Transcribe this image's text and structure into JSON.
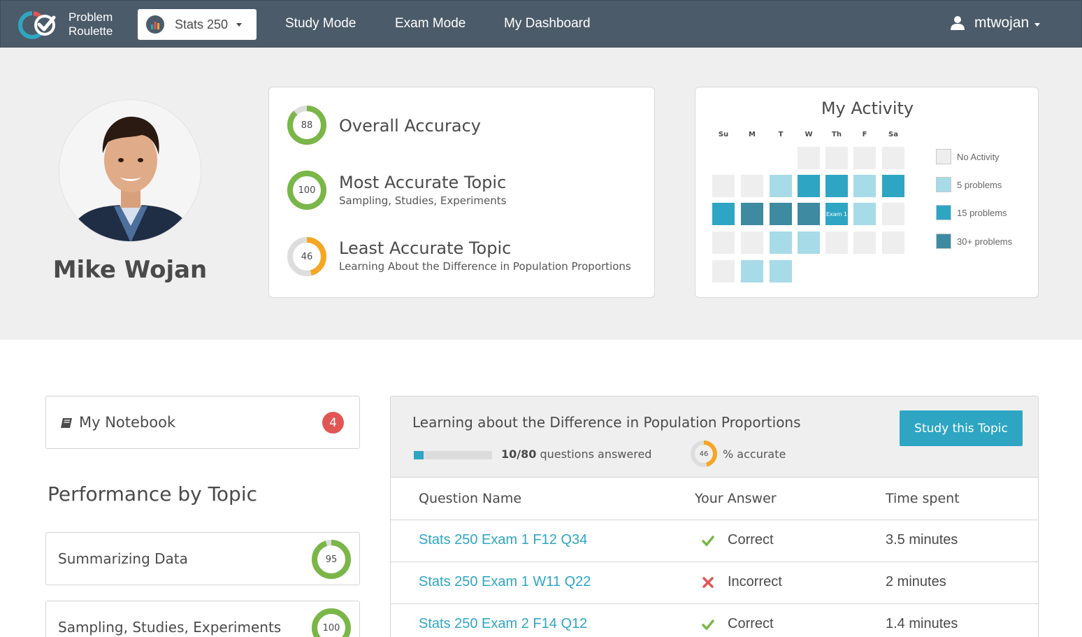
{
  "brand": {
    "line1": "Problem",
    "line2": "Roulette"
  },
  "course_select": {
    "label": "Stats 250",
    "icon": "chart-icon"
  },
  "nav": {
    "study_mode": "Study Mode",
    "exam_mode": "Exam Mode",
    "dashboard": "My Dashboard"
  },
  "user": {
    "name": "mtwojan",
    "icon": "user-icon"
  },
  "profile": {
    "name": "Mike Wojan"
  },
  "stats": {
    "overall": {
      "title": "Overall Accuracy",
      "value": 88,
      "color": "#7ab648"
    },
    "most": {
      "title": "Most Accurate Topic",
      "subtitle": "Sampling, Studies, Experiments",
      "value": 100,
      "color": "#7ab648"
    },
    "least": {
      "title": "Least Accurate Topic",
      "subtitle": "Learning About the Difference in Population Proportions",
      "value": 46,
      "color": "#f5a623"
    }
  },
  "activity": {
    "title": "My Activity",
    "days": [
      "Su",
      "M",
      "T",
      "W",
      "Th",
      "F",
      "Sa"
    ],
    "weeks": [
      [
        null,
        null,
        null,
        0,
        0,
        0,
        0
      ],
      [
        0,
        0,
        1,
        2,
        2,
        1,
        2
      ],
      [
        2,
        3,
        3,
        3,
        2,
        1,
        0
      ],
      [
        0,
        0,
        1,
        1,
        0,
        0,
        0
      ],
      [
        0,
        1,
        1,
        null,
        null,
        null,
        null
      ]
    ],
    "exam_marker": {
      "week": 2,
      "day": 4,
      "label": "Exam 1"
    },
    "legend": [
      {
        "label": "No Activity",
        "color": "#eeeeee"
      },
      {
        "label": "5 problems",
        "color": "#a7dbe8"
      },
      {
        "label": "15 problems",
        "color": "#2ea6c3"
      },
      {
        "label": "30+ problems",
        "color": "#3d8aa1"
      }
    ]
  },
  "notebook": {
    "label": "My Notebook",
    "badge": "4",
    "icon": "book-icon"
  },
  "performance": {
    "title": "Performance by Topic",
    "topics": [
      {
        "name": "Summarizing Data",
        "value": 95,
        "color": "#7ab648"
      },
      {
        "name": "Sampling, Studies, Experiments",
        "value": 100,
        "color": "#7ab648"
      }
    ]
  },
  "detail": {
    "title": "Learning about the Difference in Population Proportions",
    "answered_count": "10/80",
    "answered_label": "questions answered",
    "answered_fraction": 0.125,
    "accuracy": 46,
    "accuracy_color": "#f5a623",
    "accuracy_label": "% accurate",
    "study_button": "Study this Topic",
    "columns": [
      "Question Name",
      "Your Answer",
      "Time spent"
    ],
    "rows": [
      {
        "question": "Stats 250 Exam 1 F12 Q34",
        "answer": "Correct",
        "correct": true,
        "time": "3.5 minutes"
      },
      {
        "question": "Stats 250 Exam 1 W11 Q22",
        "answer": "Incorrect",
        "correct": false,
        "time": "2 minutes"
      },
      {
        "question": "Stats 250 Exam 2 F14 Q12",
        "answer": "Correct",
        "correct": true,
        "time": "1.4 minutes"
      }
    ]
  },
  "colors": {
    "nav_bg": "#4c5b69",
    "accent": "#2ea6c3",
    "success": "#7ab648",
    "warning": "#f5a623",
    "danger": "#e25555"
  }
}
